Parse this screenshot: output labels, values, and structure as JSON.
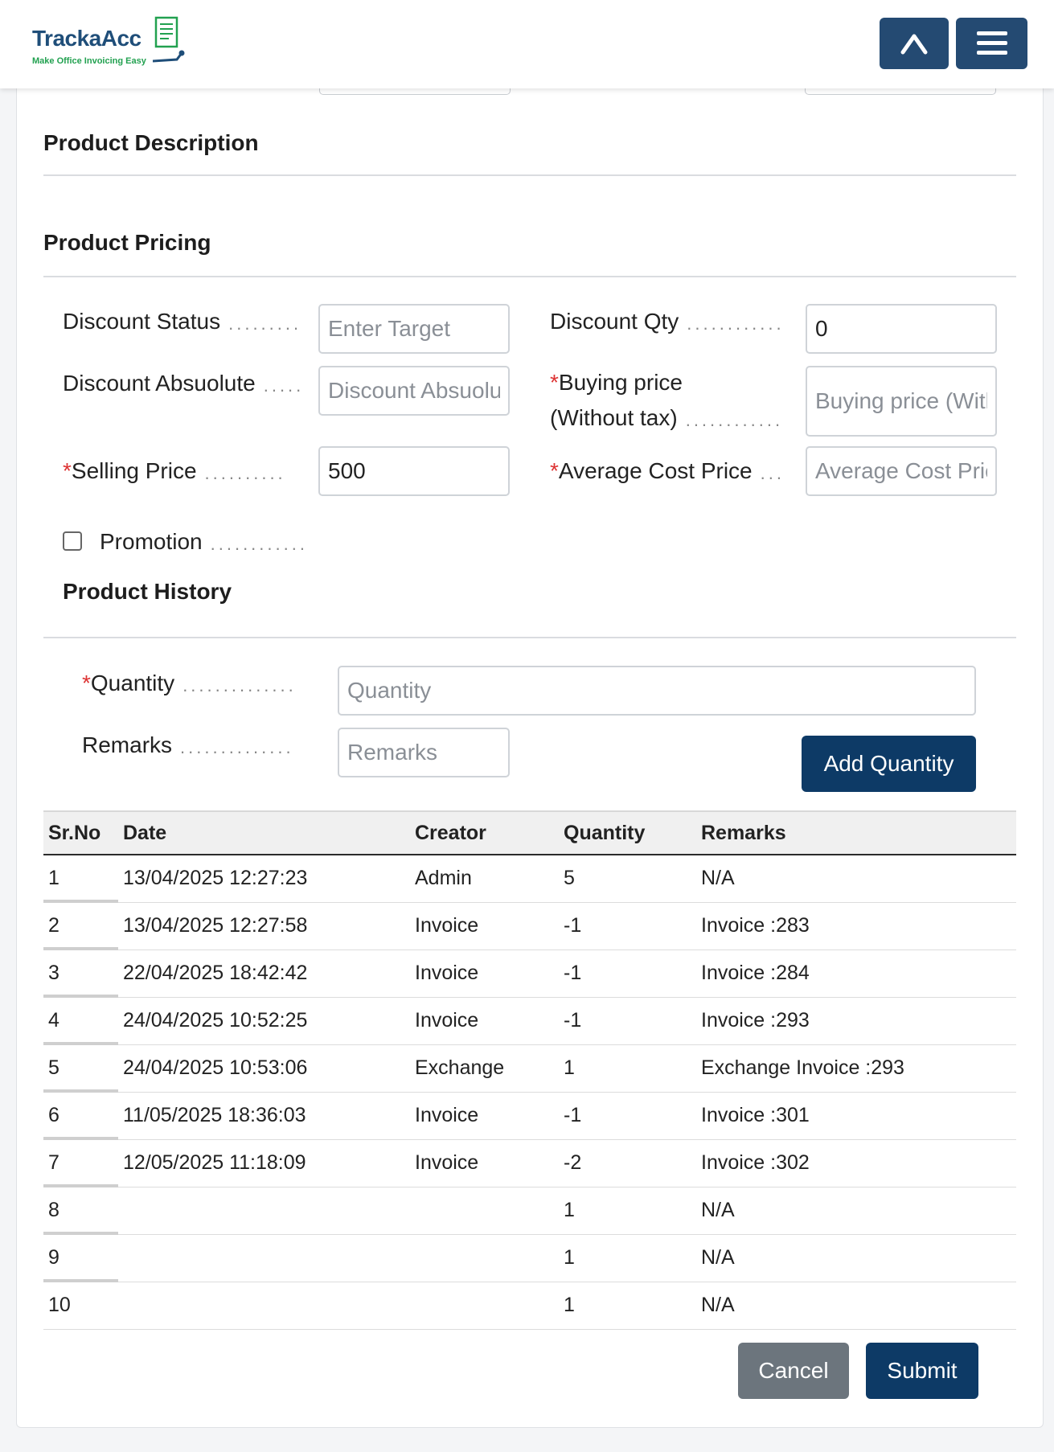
{
  "header": {
    "logo_text": "TrackaAcc",
    "logo_tagline": "Make Office Invoicing Easy",
    "collapse_icon": "chevron-up-icon",
    "menu_icon": "hamburger-menu-icon",
    "brand_color": "#244a72"
  },
  "sections": {
    "description_title": "Product Description",
    "pricing_title": "Product Pricing",
    "history_title": "Product History"
  },
  "pricing": {
    "discount_status": {
      "label": "Discount Status",
      "value": "",
      "placeholder": "Enter Target"
    },
    "discount_qty": {
      "label": "Discount Qty",
      "value": "0",
      "placeholder": ""
    },
    "discount_absolute": {
      "label": "Discount Absuolute",
      "value": "",
      "placeholder": "Discount Absuolute"
    },
    "buying_price": {
      "label_line1": "Buying price",
      "label_line2": "(Without tax)",
      "value": "",
      "placeholder": "Buying price (Without tax)"
    },
    "selling_price": {
      "label": "Selling Price",
      "value": "500",
      "placeholder": ""
    },
    "average_cost": {
      "label": "Average Cost Price",
      "value": "",
      "placeholder": "Average Cost Price"
    },
    "promotion": {
      "label": "Promotion",
      "checked": false
    }
  },
  "history_form": {
    "quantity": {
      "label": "Quantity",
      "value": "",
      "placeholder": "Quantity"
    },
    "remarks": {
      "label": "Remarks",
      "value": "",
      "placeholder": "Remarks"
    },
    "add_button": "Add Quantity"
  },
  "table": {
    "columns": [
      "Sr.No",
      "Date",
      "Creator",
      "Quantity",
      "Remarks"
    ],
    "rows": [
      [
        "1",
        "13/04/2025 12:27:23",
        "Admin",
        "5",
        "N/A"
      ],
      [
        "2",
        "13/04/2025 12:27:58",
        "Invoice",
        "-1",
        "Invoice :283"
      ],
      [
        "3",
        "22/04/2025 18:42:42",
        "Invoice",
        "-1",
        "Invoice :284"
      ],
      [
        "4",
        "24/04/2025 10:52:25",
        "Invoice",
        "-1",
        "Invoice :293"
      ],
      [
        "5",
        "24/04/2025 10:53:06",
        "Exchange",
        "1",
        "Exchange Invoice :293"
      ],
      [
        "6",
        "11/05/2025 18:36:03",
        "Invoice",
        "-1",
        "Invoice :301"
      ],
      [
        "7",
        "12/05/2025 11:18:09",
        "Invoice",
        "-2",
        "Invoice :302"
      ],
      [
        "8",
        "",
        "",
        "1",
        "N/A"
      ],
      [
        "9",
        "",
        "",
        "1",
        "N/A"
      ],
      [
        "10",
        "",
        "",
        "1",
        "N/A"
      ]
    ]
  },
  "footer": {
    "cancel": "Cancel",
    "submit": "Submit"
  },
  "required_marker": "*"
}
